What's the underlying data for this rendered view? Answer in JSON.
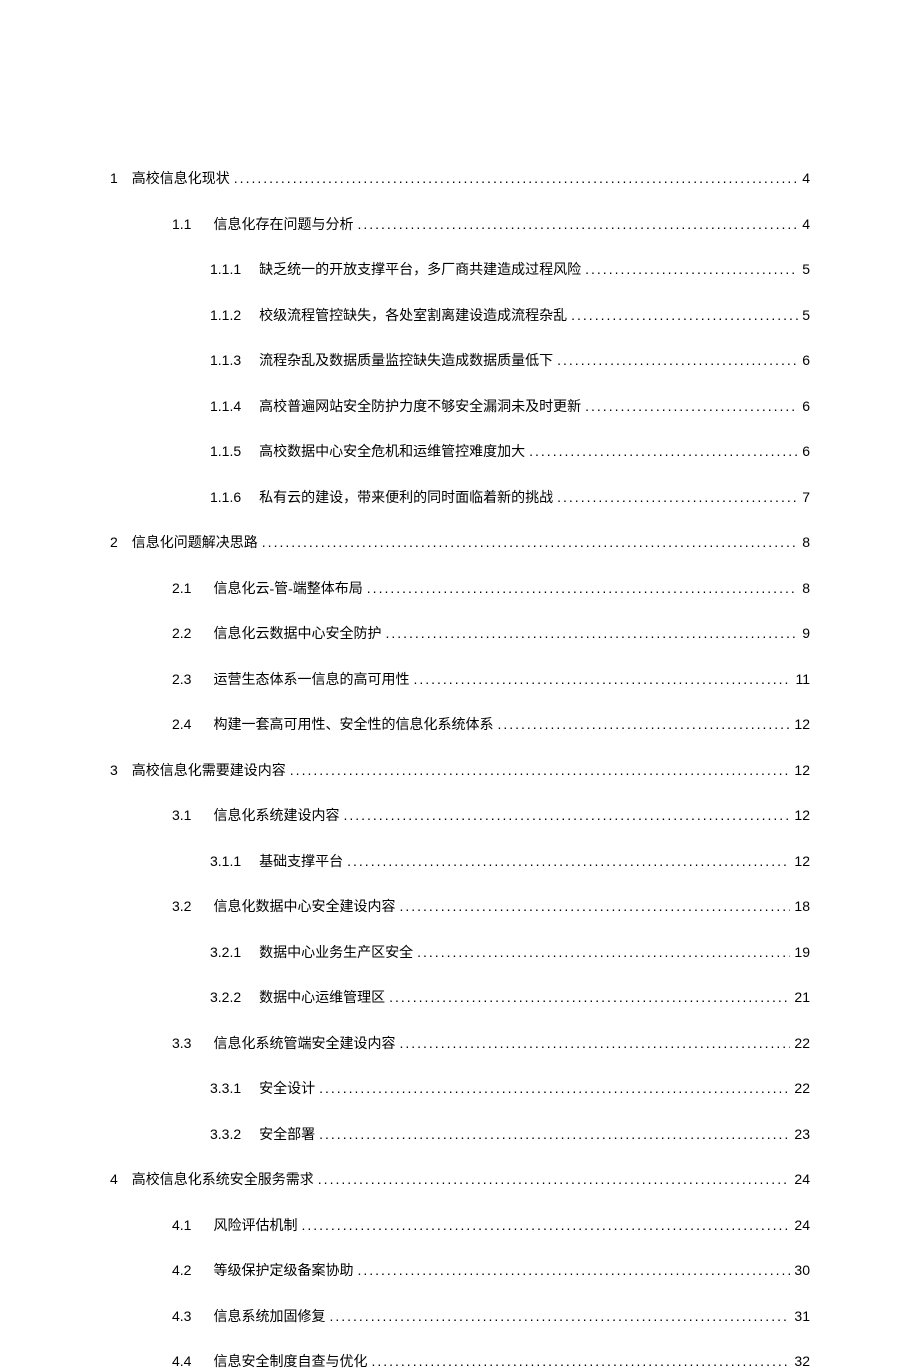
{
  "toc": [
    {
      "level": 1,
      "number": "1",
      "title": "高校信息化现状",
      "page": "4"
    },
    {
      "level": 2,
      "number": "1.1",
      "title": "信息化存在问题与分析",
      "page": "4"
    },
    {
      "level": 3,
      "number": "1.1.1",
      "title": "缺乏统一的开放支撑平台，多厂商共建造成过程风险",
      "page": "5"
    },
    {
      "level": 3,
      "number": "1.1.2",
      "title": "校级流程管控缺失，各处室割离建设造成流程杂乱",
      "page": "5"
    },
    {
      "level": 3,
      "number": "1.1.3",
      "title": "流程杂乱及数据质量监控缺失造成数据质量低下",
      "page": "6"
    },
    {
      "level": 3,
      "number": "1.1.4",
      "title": "高校普遍网站安全防护力度不够安全漏洞未及时更新",
      "page": "6"
    },
    {
      "level": 3,
      "number": "1.1.5",
      "title": "高校数据中心安全危机和运维管控难度加大",
      "page": "6"
    },
    {
      "level": 3,
      "number": "1.1.6",
      "title": "私有云的建设，带来便利的同时面临着新的挑战",
      "page": "7"
    },
    {
      "level": 1,
      "number": "2",
      "title": "信息化问题解决思路",
      "page": "8"
    },
    {
      "level": 2,
      "number": "2.1",
      "title": "信息化云-管-端整体布局",
      "page": "8"
    },
    {
      "level": 2,
      "number": "2.2",
      "title": "信息化云数据中心安全防护",
      "page": "9"
    },
    {
      "level": 2,
      "number": "2.3",
      "title": "运营生态体系一信息的高可用性",
      "page": "11"
    },
    {
      "level": 2,
      "number": "2.4",
      "title": "构建一套高可用性、安全性的信息化系统体系",
      "page": "12"
    },
    {
      "level": 1,
      "number": "3",
      "title": "高校信息化需要建设内容",
      "page": "12"
    },
    {
      "level": 2,
      "number": "3.1",
      "title": "信息化系统建设内容",
      "page": "12"
    },
    {
      "level": 3,
      "number": "3.1.1",
      "title": "基础支撑平台",
      "page": "12"
    },
    {
      "level": 2,
      "number": "3.2",
      "title": "信息化数据中心安全建设内容",
      "page": "18"
    },
    {
      "level": 3,
      "number": "3.2.1",
      "title": "数据中心业务生产区安全",
      "page": "19"
    },
    {
      "level": 3,
      "number": "3.2.2",
      "title": "数据中心运维管理区",
      "page": "21"
    },
    {
      "level": 2,
      "number": "3.3",
      "title": "信息化系统管端安全建设内容",
      "page": "22"
    },
    {
      "level": 3,
      "number": "3.3.1",
      "title": "安全设计",
      "page": "22"
    },
    {
      "level": 3,
      "number": "3.3.2",
      "title": "安全部署",
      "page": "23"
    },
    {
      "level": 1,
      "number": "4",
      "title": "高校信息化系统安全服务需求",
      "page": "24"
    },
    {
      "level": 2,
      "number": "4.1",
      "title": "风险评估机制",
      "page": "24"
    },
    {
      "level": 2,
      "number": "4.2",
      "title": "等级保护定级备案协助",
      "page": "30"
    },
    {
      "level": 2,
      "number": "4.3",
      "title": "信息系统加固修复",
      "page": "31"
    },
    {
      "level": 2,
      "number": "4.4",
      "title": "信息安全制度自查与优化",
      "page": "32"
    }
  ]
}
